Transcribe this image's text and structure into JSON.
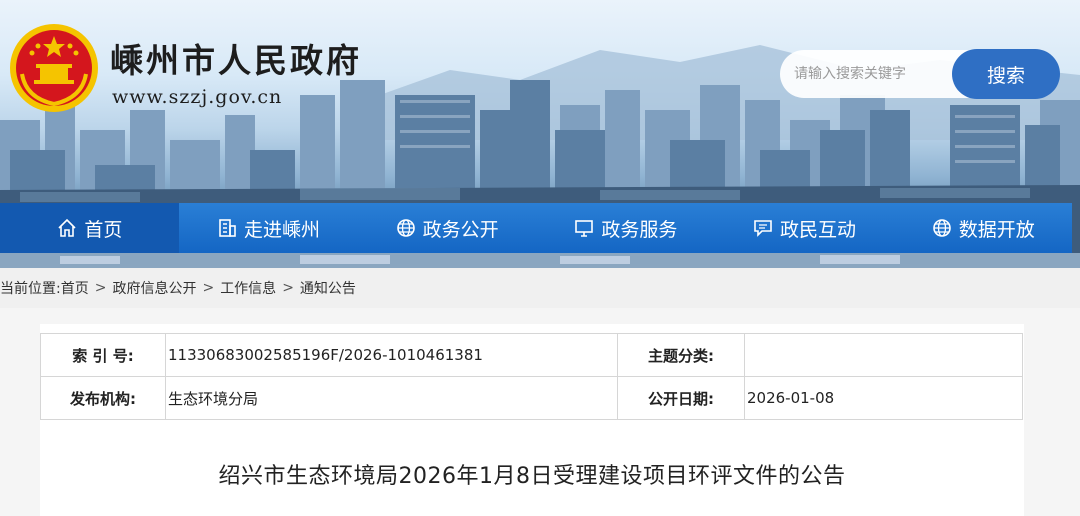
{
  "header": {
    "site_title": "嵊州市人民政府",
    "site_url": "www.szzj.gov.cn",
    "search_placeholder": "请输入搜索关键字",
    "search_button": "搜索"
  },
  "nav": {
    "items": [
      {
        "label": "首页",
        "icon": "home-icon"
      },
      {
        "label": "走进嵊州",
        "icon": "building-icon"
      },
      {
        "label": "政务公开",
        "icon": "globe-icon"
      },
      {
        "label": "政务服务",
        "icon": "monitor-icon"
      },
      {
        "label": "政民互动",
        "icon": "chat-icon"
      },
      {
        "label": "数据开放",
        "icon": "globe-icon"
      }
    ]
  },
  "breadcrumb": {
    "prefix": "当前位置:",
    "items": [
      "首页",
      "政府信息公开",
      "工作信息",
      "通知公告"
    ],
    "separator": ">"
  },
  "meta": {
    "index_label": "索 引 号:",
    "index_value": "11330683002585196F/2026-1010461381",
    "topic_label": "主题分类:",
    "topic_value": "",
    "publisher_label": "发布机构:",
    "publisher_value": "生态环境分局",
    "date_label": "公开日期:",
    "date_value": "2026-01-08"
  },
  "document": {
    "title": "绍兴市生态环境局2026年1月8日受理建设项目环评文件的公告"
  },
  "colors": {
    "nav_blue": "#1466c4",
    "search_button": "#2f6fc4",
    "emblem_red": "#d4161d",
    "emblem_gold": "#f5c400"
  }
}
